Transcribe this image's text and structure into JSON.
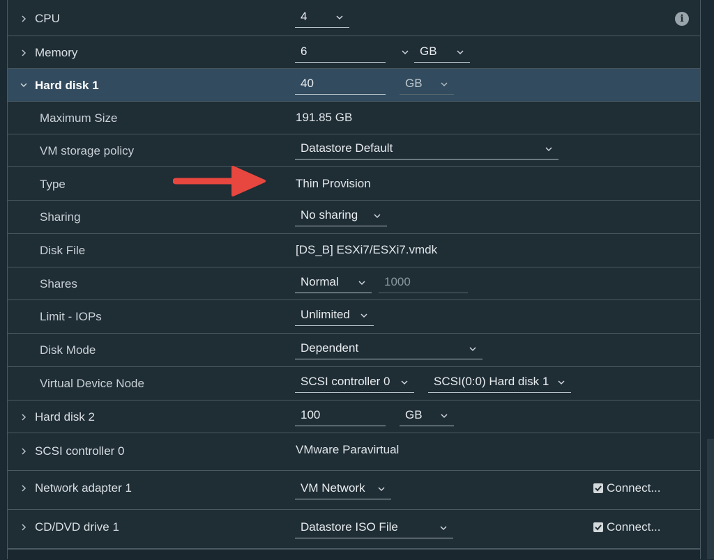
{
  "rows": {
    "cpu": {
      "label": "CPU",
      "value": "4"
    },
    "memory": {
      "label": "Memory",
      "value": "6",
      "unit": "GB"
    },
    "hard_disk_1": {
      "label": "Hard disk 1",
      "value": "40",
      "unit": "GB"
    },
    "max_size": {
      "label": "Maximum Size",
      "value": "191.85 GB"
    },
    "storage_policy": {
      "label": "VM storage policy",
      "value": "Datastore Default"
    },
    "type": {
      "label": "Type",
      "value": "Thin Provision"
    },
    "sharing": {
      "label": "Sharing",
      "value": "No sharing"
    },
    "disk_file": {
      "label": "Disk File",
      "value": "[DS_B] ESXi7/ESXi7.vmdk"
    },
    "shares": {
      "label": "Shares",
      "value": "Normal",
      "number": "1000"
    },
    "limit_iops": {
      "label": "Limit - IOPs",
      "value": "Unlimited"
    },
    "disk_mode": {
      "label": "Disk Mode",
      "value": "Dependent"
    },
    "virtual_device_node": {
      "label": "Virtual Device Node",
      "controller": "SCSI controller 0",
      "node": "SCSI(0:0) Hard disk 1"
    },
    "hard_disk_2": {
      "label": "Hard disk 2",
      "value": "100",
      "unit": "GB"
    },
    "scsi_controller": {
      "label": "SCSI controller 0",
      "value": "VMware Paravirtual"
    },
    "network_adapter": {
      "label": "Network adapter 1",
      "value": "VM Network",
      "connect": "Connect..."
    },
    "cd_dvd": {
      "label": "CD/DVD drive 1",
      "value": "Datastore ISO File",
      "connect": "Connect..."
    }
  },
  "icons": {
    "info": "info-icon",
    "arrow": "red-arrow-annotation"
  },
  "colors": {
    "panel": "#1f2d35",
    "active_row": "#324b5e",
    "arrow": "#e8473f"
  }
}
